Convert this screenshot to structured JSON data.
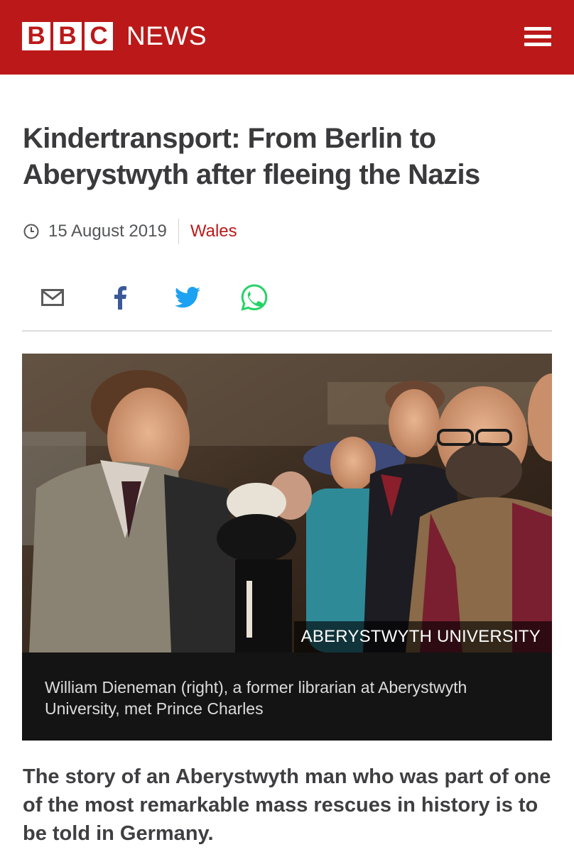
{
  "header": {
    "logo_letters": [
      "B",
      "B",
      "C"
    ],
    "logo_word": "NEWS",
    "brand_color": "#bb1919",
    "menu_icon": "hamburger-menu-icon"
  },
  "article": {
    "headline": "Kindertransport: From Berlin to Aberystwyth after fleeing the Nazis",
    "date": "15 August 2019",
    "section": "Wales",
    "share_icons": [
      "email-icon",
      "facebook-icon",
      "twitter-icon",
      "whatsapp-icon"
    ],
    "image": {
      "credit": "ABERYSTWYTH UNIVERSITY",
      "caption": "William Dieneman (right), a former librarian at Aberystwyth University, met Prince Charles"
    },
    "intro": "The story of an Aberystwyth man who was part of one of the most remarkable mass rescues in history is to be told in Germany."
  },
  "colors": {
    "facebook": "#3b5998",
    "twitter": "#1da1f2",
    "whatsapp": "#25d366",
    "section_link": "#bb1919"
  }
}
